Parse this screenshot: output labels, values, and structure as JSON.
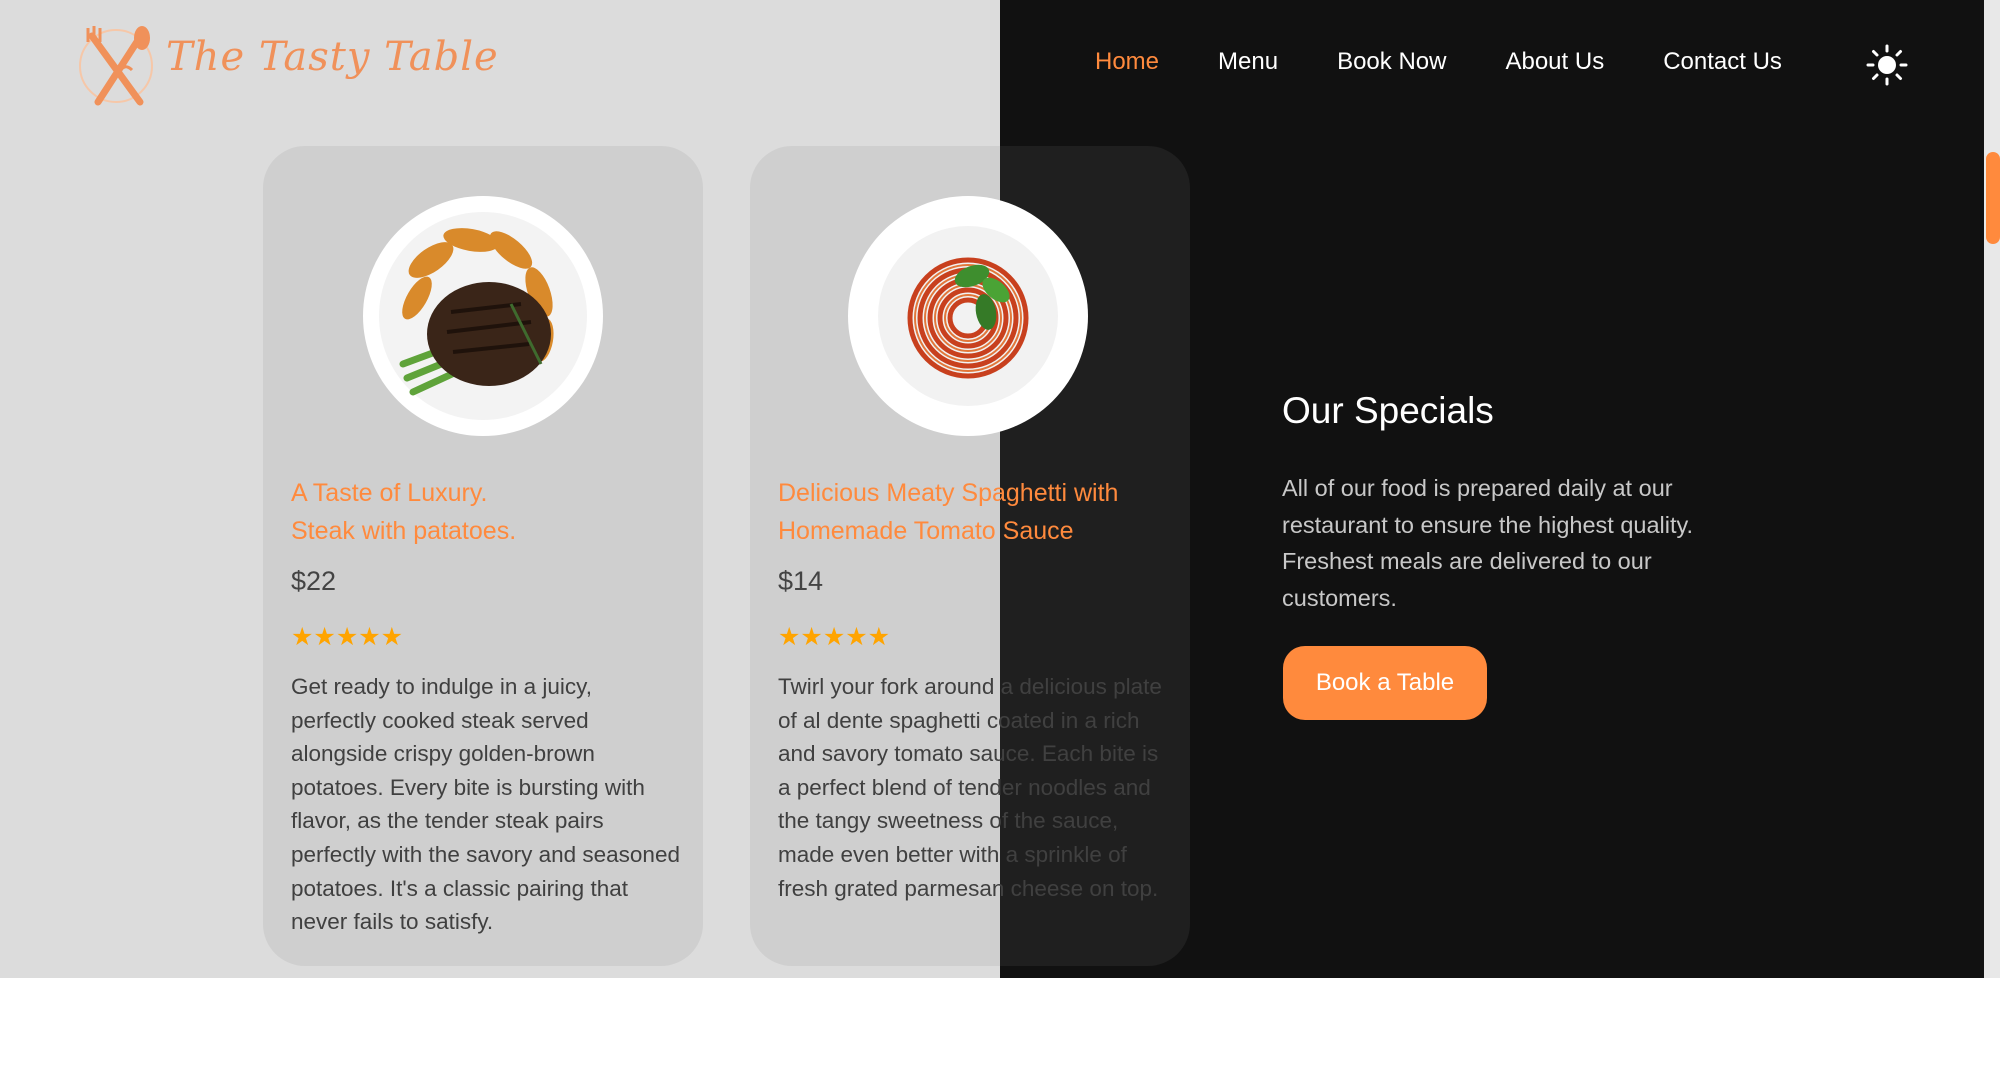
{
  "brand": {
    "logo_text": "The Tasty Table"
  },
  "nav": {
    "items": [
      {
        "label": "Home",
        "active": true
      },
      {
        "label": "Menu",
        "active": false
      },
      {
        "label": "Book Now",
        "active": false
      },
      {
        "label": "About Us",
        "active": false
      },
      {
        "label": "Contact Us",
        "active": false
      }
    ],
    "theme_icon": "sun-icon"
  },
  "cards": [
    {
      "title_line1": "A Taste of Luxury.",
      "title_line2": "Steak with patatoes.",
      "price": "$22",
      "rating": "★★★★★",
      "description": "Get ready to indulge in a juicy, perfectly cooked steak served alongside crispy golden-brown potatoes. Every bite is bursting with flavor, as the tender steak pairs perfectly with the savory and seasoned potatoes. It's a classic pairing that never fails to satisfy."
    },
    {
      "title_line1": "Delicious Meaty Spaghetti with",
      "title_line2": "Homemade Tomato Sauce",
      "price": "$14",
      "rating": "★★★★★",
      "description": "Twirl your fork around a delicious plate of al dente spaghetti coated in a rich and savory tomato sauce. Each bite is a perfect blend of tender noodles and the tangy sweetness of the sauce, made even better with a sprinkle of fresh grated parmesan cheese on top."
    }
  ],
  "specials": {
    "title": "Our Specials",
    "text": "All of our food is prepared daily at our restaurant to ensure the highest quality. Freshest meals are delivered to our customers.",
    "button": "Book a Table"
  },
  "colors": {
    "accent": "#ff8a3d",
    "light_bg": "#dcdcdc",
    "dark_bg": "#111111",
    "star": "#ffa400"
  }
}
